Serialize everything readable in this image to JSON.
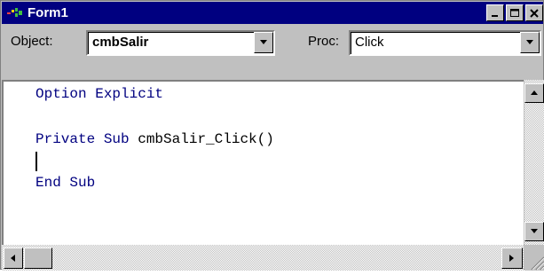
{
  "window": {
    "title": "Form1",
    "icon": "form-icon",
    "caption_buttons": [
      "minimize-icon",
      "maximize-icon",
      "close-icon"
    ]
  },
  "toolbar": {
    "object_label": "Object:",
    "object_value": "cmbSalir",
    "proc_label": "Proc:",
    "proc_value": "Click"
  },
  "code": {
    "line1_keywords": "Option Explicit",
    "line2_keywords": "Private Sub",
    "line2_name": " cmbSalir_Click()",
    "line3_keywords": "End Sub"
  },
  "colors": {
    "title_bar": "#000080",
    "keyword": "#000080",
    "face": "#c0c0c0"
  }
}
